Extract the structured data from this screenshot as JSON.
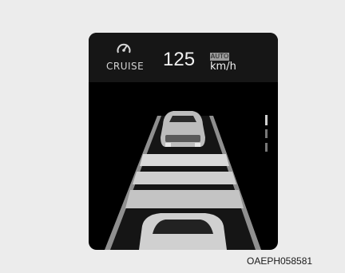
{
  "cluster": {
    "cruise_label": "CRUISE",
    "set_speed": "125",
    "mode_badge": "AUTO",
    "speed_unit": "km/h",
    "icons": {
      "cruise": "cruise-control-icon",
      "lead_vehicle": "lead-vehicle-icon",
      "own_vehicle": "own-vehicle-icon"
    },
    "distance_setting_bars": 3
  },
  "figure": {
    "code": "OAEPH058581"
  },
  "colors": {
    "background": "#ececec",
    "display": "#000000",
    "text": "#f2f2f2",
    "badge": "#9a9a9a"
  }
}
